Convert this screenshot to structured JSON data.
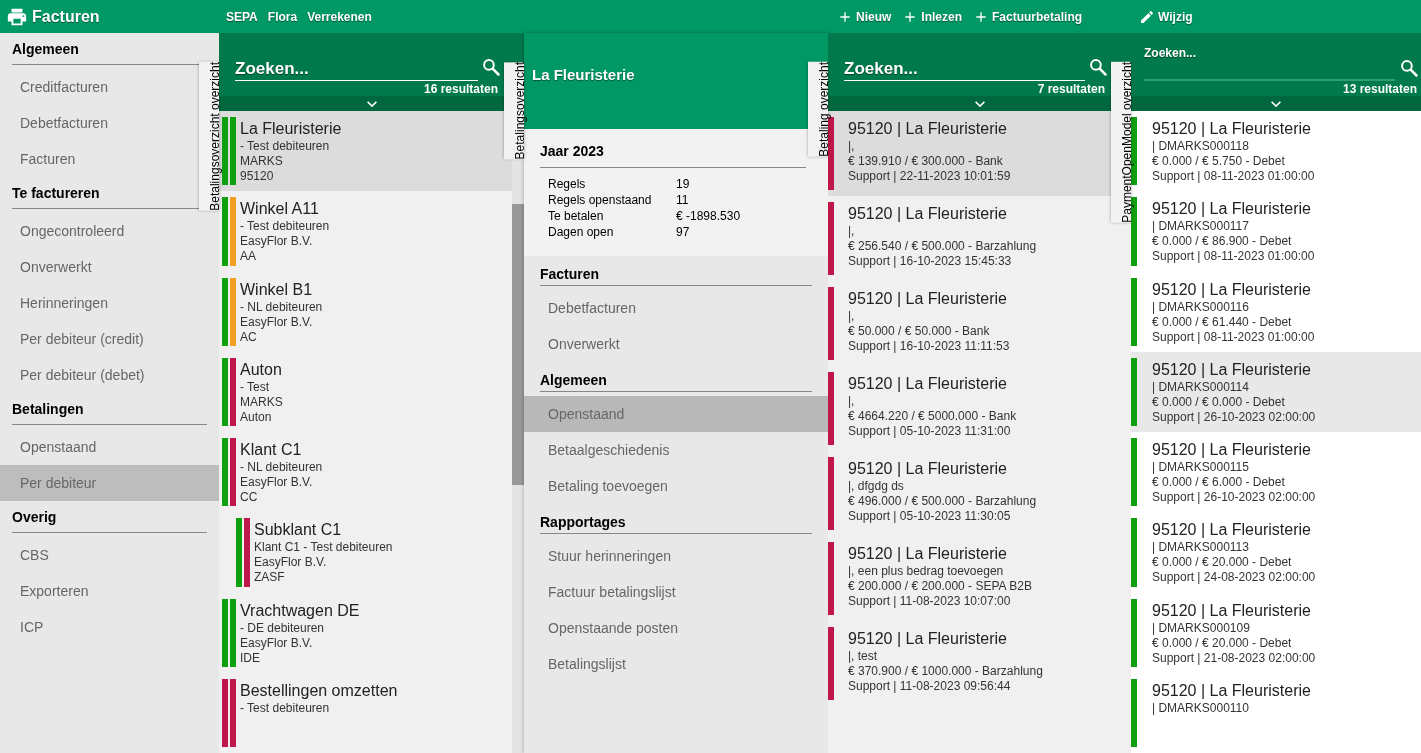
{
  "app": {
    "title": "Facturen"
  },
  "sidebar": {
    "sections": [
      {
        "heading": "Algemeen",
        "items": [
          {
            "label": "Creditfacturen",
            "selected": false
          },
          {
            "label": "Debetfacturen",
            "selected": false
          },
          {
            "label": "Facturen",
            "selected": false
          }
        ]
      },
      {
        "heading": "Te factureren",
        "items": [
          {
            "label": "Ongecontroleerd",
            "selected": false
          },
          {
            "label": "Onverwerkt",
            "selected": false
          },
          {
            "label": "Herinneringen",
            "selected": false
          },
          {
            "label": "Per debiteur (credit)",
            "selected": false
          },
          {
            "label": "Per debiteur (debet)",
            "selected": false
          }
        ]
      },
      {
        "heading": "Betalingen",
        "items": [
          {
            "label": "Openstaand",
            "selected": false
          },
          {
            "label": "Per debiteur",
            "selected": true
          }
        ]
      },
      {
        "heading": "Overig",
        "items": [
          {
            "label": "CBS",
            "selected": false
          },
          {
            "label": "Exporteren",
            "selected": false
          },
          {
            "label": "ICP",
            "selected": false
          }
        ]
      }
    ]
  },
  "customer_panel": {
    "actions": [
      {
        "label": "SEPA"
      },
      {
        "label": "Flora"
      },
      {
        "label": "Verrekenen"
      }
    ],
    "tab": "Betalingsoverzicht overzicht",
    "search": {
      "placeholder": "Zoeken..."
    },
    "result_count": "16 resultaten",
    "customers": [
      {
        "title": "La Fleuristerie",
        "lines": [
          "- Test debiteuren",
          "MARKS",
          "95120"
        ],
        "selected": true,
        "stripes": [
          {
            "color": "#0fa00f"
          },
          {
            "color": "#0fa00f"
          }
        ]
      },
      {
        "title": "Winkel A11",
        "lines": [
          "- Test debiteuren",
          "EasyFlor B.V.",
          "AA"
        ],
        "selected": false,
        "stripes": [
          {
            "color": "#0fa00f"
          },
          {
            "color": "#f0a020"
          }
        ]
      },
      {
        "title": "Winkel B1",
        "lines": [
          "- NL debiteuren",
          "EasyFlor B.V.",
          "AC"
        ],
        "selected": false,
        "stripes": [
          {
            "color": "#0fa00f"
          },
          {
            "color": "#f0a020"
          }
        ]
      },
      {
        "title": "Auton",
        "lines": [
          "- Test",
          "MARKS",
          "Auton"
        ],
        "selected": false,
        "stripes": [
          {
            "color": "#0fa00f"
          },
          {
            "color": "#c0174a"
          }
        ]
      },
      {
        "title": "Klant C1",
        "lines": [
          "- NL debiteuren",
          "EasyFlor B.V.",
          "CC"
        ],
        "selected": false,
        "stripes": [
          {
            "color": "#0fa00f"
          },
          {
            "color": "#c0174a"
          }
        ],
        "children": [
          {
            "title": "Subklant C1",
            "lines": [
              "Klant C1 - Test debiteuren",
              "EasyFlor B.V.",
              "ZASF"
            ],
            "selected": false,
            "stripes": [
              {
                "color": "#0fa00f"
              },
              {
                "color": "#c0174a"
              }
            ]
          }
        ]
      },
      {
        "title": "Vrachtwagen DE",
        "lines": [
          "- DE debiteuren",
          "EasyFlor B.V.",
          "IDE"
        ],
        "selected": false,
        "stripes": [
          {
            "color": "#0fa00f"
          },
          {
            "color": "#0fa00f"
          }
        ]
      },
      {
        "title": "Bestellingen omzetten",
        "lines": [
          "- Test debiteuren"
        ],
        "selected": false,
        "stripes": [
          {
            "color": "#c0174a"
          },
          {
            "color": "#c0174a"
          }
        ]
      }
    ]
  },
  "detail_panel": {
    "tab": "Betalingsoverzicht",
    "title": "La Fleuristerie",
    "year": {
      "heading": "Jaar 2023",
      "stats": [
        {
          "label": "Regels",
          "value": "19"
        },
        {
          "label": "Regels openstaand",
          "value": "11"
        },
        {
          "label": "Te betalen",
          "value": "€ -1898.530"
        },
        {
          "label": "Dagen open",
          "value": "97"
        }
      ]
    },
    "sections": [
      {
        "heading": "Facturen",
        "items": [
          {
            "label": "Debetfacturen",
            "selected": false
          },
          {
            "label": "Onverwerkt",
            "selected": false
          }
        ]
      },
      {
        "heading": "Algemeen",
        "items": [
          {
            "label": "Openstaand",
            "selected": true
          },
          {
            "label": "Betaalgeschiedenis",
            "selected": false
          },
          {
            "label": "Betaling toevoegen",
            "selected": false
          }
        ]
      },
      {
        "heading": "Rapportages",
        "items": [
          {
            "label": "Stuur herinneringen",
            "selected": false
          },
          {
            "label": "Factuur betalingslijst",
            "selected": false
          },
          {
            "label": "Openstaande posten",
            "selected": false
          },
          {
            "label": "Betalingslijst",
            "selected": false
          }
        ]
      }
    ]
  },
  "payment_panel": {
    "actions": [
      {
        "label": "Nieuw",
        "kind": "add"
      },
      {
        "label": "Inlezen",
        "kind": "add"
      },
      {
        "label": "Factuurbetaling",
        "kind": "add"
      }
    ],
    "tab": "Betaling overzicht",
    "search": {
      "placeholder": "Zoeken..."
    },
    "result_count": "7 resultaten",
    "payments": [
      {
        "title": "95120 | La Fleuristerie",
        "lines": [
          "|,",
          "€ 139.910 / € 300.000 - Bank",
          "Support | 22-11-2023 10:01:59"
        ],
        "selected": true,
        "color": "#c0174a"
      },
      {
        "title": "95120 | La Fleuristerie",
        "lines": [
          "|,",
          "€ 256.540 / € 500.000 - Barzahlung",
          "Support | 16-10-2023 15:45:33"
        ],
        "selected": false,
        "color": "#c0174a"
      },
      {
        "title": "95120 | La Fleuristerie",
        "lines": [
          "|,",
          "€ 50.000 / € 50.000 - Bank",
          "Support | 16-10-2023 11:11:53"
        ],
        "selected": false,
        "color": "#c0174a"
      },
      {
        "title": "95120 | La Fleuristerie",
        "lines": [
          "|,",
          "€ 4664.220 / € 5000.000 - Bank",
          "Support | 05-10-2023 11:31:00"
        ],
        "selected": false,
        "color": "#c0174a"
      },
      {
        "title": "95120 | La Fleuristerie",
        "lines": [
          "|, dfgdg ds",
          "€ 496.000 / € 500.000 - Barzahlung",
          "Support | 05-10-2023 11:30:05"
        ],
        "selected": false,
        "color": "#c0174a"
      },
      {
        "title": "95120 | La Fleuristerie",
        "lines": [
          "|, een plus bedrag toevoegen",
          "€ 200.000 / € 200.000 - SEPA B2B",
          "Support | 11-08-2023 10:07:00"
        ],
        "selected": false,
        "color": "#c0174a"
      },
      {
        "title": "95120 | La Fleuristerie",
        "lines": [
          "|, test",
          "€ 370.900 / € 1000.000 - Barzahlung",
          "Support | 11-08-2023 09:56:44"
        ],
        "selected": false,
        "color": "#c0174a"
      }
    ]
  },
  "open_panel": {
    "actions": [
      {
        "label": "Wijzig",
        "kind": "edit"
      }
    ],
    "tab": "PaymentOpenModel overzicht",
    "search": {
      "label": "Zoeken..."
    },
    "result_count": "13 resultaten",
    "items": [
      {
        "title": "95120 | La Fleuristerie",
        "lines": [
          "| DMARKS000118",
          "€ 0.000 / € 5.750 - Debet",
          "Support | 08-11-2023 01:00:00"
        ],
        "selected": false,
        "color": "#0fa00f"
      },
      {
        "title": "95120 | La Fleuristerie",
        "lines": [
          "| DMARKS000117",
          "€ 0.000 / € 86.900 - Debet",
          "Support | 08-11-2023 01:00:00"
        ],
        "selected": false,
        "color": "#0fa00f"
      },
      {
        "title": "95120 | La Fleuristerie",
        "lines": [
          "| DMARKS000116",
          "€ 0.000 / € 61.440 - Debet",
          "Support | 08-11-2023 01:00:00"
        ],
        "selected": false,
        "color": "#0fa00f"
      },
      {
        "title": "95120 | La Fleuristerie",
        "lines": [
          "| DMARKS000114",
          "€ 0.000 / € 0.000 - Debet",
          "Support | 26-10-2023 02:00:00"
        ],
        "selected": true,
        "color": "#0fa00f"
      },
      {
        "title": "95120 | La Fleuristerie",
        "lines": [
          "| DMARKS000115",
          "€ 0.000 / € 6.000 - Debet",
          "Support | 26-10-2023 02:00:00"
        ],
        "selected": false,
        "color": "#0fa00f"
      },
      {
        "title": "95120 | La Fleuristerie",
        "lines": [
          "| DMARKS000113",
          "€ 0.000 / € 20.000 - Debet",
          "Support | 24-08-2023 02:00:00"
        ],
        "selected": false,
        "color": "#0fa00f"
      },
      {
        "title": "95120 | La Fleuristerie",
        "lines": [
          "| DMARKS000109",
          "€ 0.000 / € 20.000 - Debet",
          "Support | 21-08-2023 02:00:00"
        ],
        "selected": false,
        "color": "#0fa00f"
      },
      {
        "title": "95120 | La Fleuristerie",
        "lines": [
          "| DMARKS000110"
        ],
        "selected": false,
        "color": "#0fa00f"
      }
    ]
  }
}
